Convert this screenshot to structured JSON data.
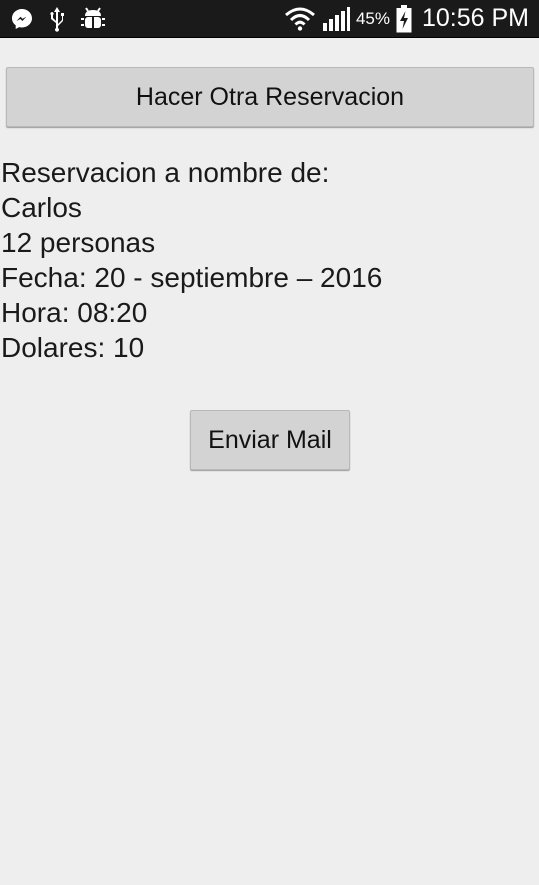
{
  "status_bar": {
    "battery_percent": "45%",
    "time": "10:56 PM",
    "icons": [
      "messenger-icon",
      "usb-icon",
      "android-debug-icon",
      "wifi-icon",
      "signal-icon",
      "battery-charging-icon"
    ]
  },
  "buttons": {
    "hacer_otra": "Hacer Otra Reservacion",
    "enviar_mail": "Enviar Mail"
  },
  "reservation": {
    "header": "Reservacion a nombre de:",
    "name": "Carlos",
    "people": "12 personas",
    "date": "Fecha: 20 - septiembre – 2016",
    "time": "Hora: 08:20",
    "dollars": "Dolares: 10"
  },
  "colors": {
    "status_bar": "#1a1a1a",
    "background": "#eeeeee",
    "button": "#d3d3d3"
  }
}
